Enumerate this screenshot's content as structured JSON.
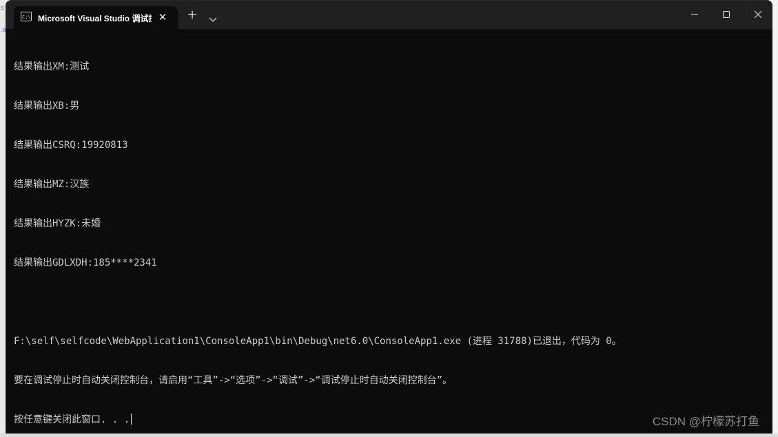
{
  "window": {
    "tab_title": "Microsoft Visual Studio 调试控制台",
    "tab_icon": "console-app-icon",
    "new_tab_glyph": "+",
    "close_glyph": "✕"
  },
  "console": {
    "lines": [
      "结果输出XM:测试",
      "结果输出XB:男",
      "结果输出CSRQ:19920813",
      "结果输出MZ:汉族",
      "结果输出HYZK:未婚",
      "结果输出GDLXDH:185****2341",
      "",
      "F:\\self\\selfcode\\WebApplication1\\ConsoleApp1\\bin\\Debug\\net6.0\\ConsoleApp1.exe (进程 31788)已退出，代码为 0。",
      "要在调试停止时自动关闭控制台，请启用“工具”->“选项”->“调试”->“调试停止时自动关闭控制台”。",
      "按任意键关闭此窗口. . ."
    ]
  },
  "watermark": "CSDN @柠檬苏打鱼",
  "left_strip_marks": [
    "s",
    ".a"
  ],
  "colors": {
    "console_bg": "#0c0c0c",
    "console_text": "#cccccc",
    "titlebar_bg": "#202020"
  }
}
